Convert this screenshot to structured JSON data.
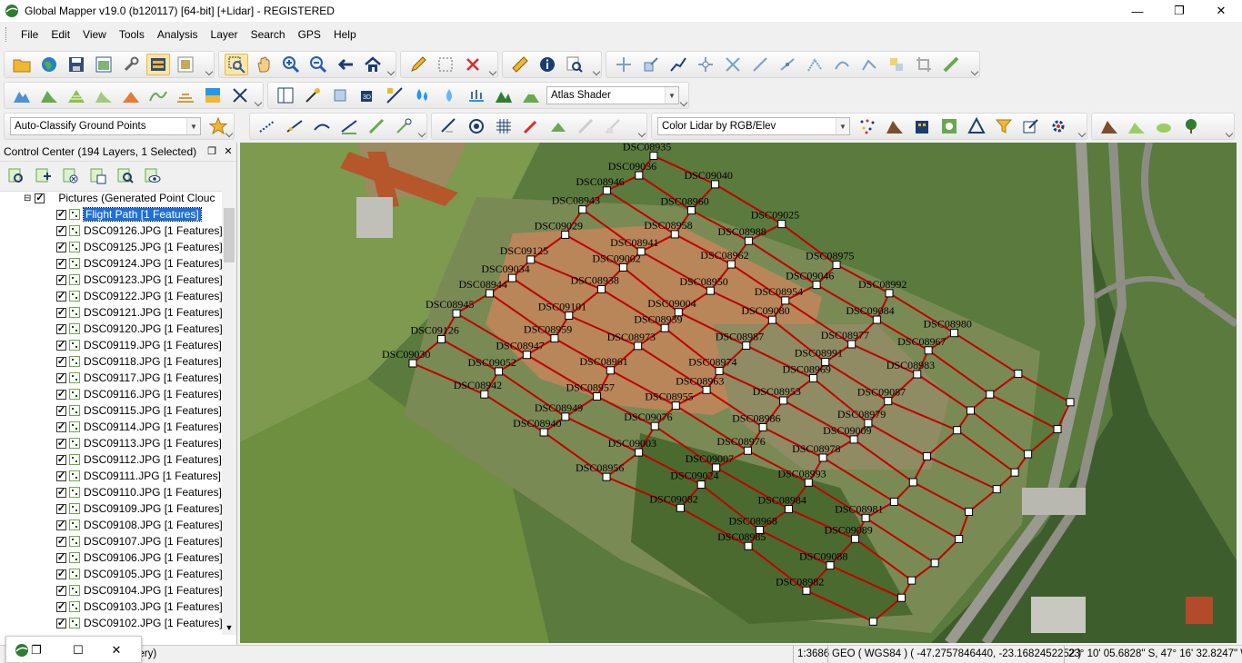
{
  "window": {
    "title": "Global Mapper v19.0 (b120117) [64-bit] [+Lidar] - REGISTERED",
    "minimize": "—",
    "maximize": "❐",
    "close": "✕"
  },
  "menu": [
    "File",
    "Edit",
    "View",
    "Tools",
    "Analysis",
    "Layer",
    "Search",
    "GPS",
    "Help"
  ],
  "toolbar": {
    "shader_value": "Atlas Shader",
    "classify_value": "Auto-Classify Ground Points",
    "lidar_color_value": "Color Lidar by RGB/Elev"
  },
  "control_center": {
    "title": "Control Center (194 Layers, 1 Selected)",
    "restore": "❐",
    "close": "✕",
    "group_label": "Pictures (Generated Point Clouc",
    "selected_layer": "Flight Path [1 Features]",
    "layers": [
      "DSC09126.JPG [1 Features]",
      "DSC09125.JPG [1 Features]",
      "DSC09124.JPG [1 Features]",
      "DSC09123.JPG [1 Features]",
      "DSC09122.JPG [1 Features]",
      "DSC09121.JPG [1 Features]",
      "DSC09120.JPG [1 Features]",
      "DSC09119.JPG [1 Features]",
      "DSC09118.JPG [1 Features]",
      "DSC09117.JPG [1 Features]",
      "DSC09116.JPG [1 Features]",
      "DSC09115.JPG [1 Features]",
      "DSC09114.JPG [1 Features]",
      "DSC09113.JPG [1 Features]",
      "DSC09112.JPG [1 Features]",
      "DSC09111.JPG [1 Features]",
      "DSC09110.JPG [1 Features]",
      "DSC09109.JPG [1 Features]",
      "DSC09108.JPG [1 Features]",
      "DSC09107.JPG [1 Features]",
      "DSC09106.JPG [1 Features]",
      "DSC09105.JPG [1 Features]",
      "DSC09104.JPG [1 Features]",
      "DSC09103.JPG [1 Features]",
      "DSC09102.JPG [1 Features]"
    ]
  },
  "map": {
    "line_color": "#c00000",
    "photo_labels": [
      "DSC09030",
      "DSC09126",
      "DSC08945",
      "DSC08944",
      "DSC09034",
      "DSC09125",
      "DSC09029",
      "DSC08943",
      "DSC08946",
      "DSC09036",
      "DSC08935",
      "DSC08942",
      "DSC09052",
      "DSC08947",
      "DSC08959",
      "DSC09101",
      "DSC08938",
      "DSC09002",
      "DSC08941",
      "DSC08958",
      "DSC08960",
      "DSC09040",
      "DSC08940",
      "DSC08949",
      "DSC08957",
      "DSC08961",
      "DSC08973",
      "DSC08939",
      "DSC09004",
      "DSC08950",
      "DSC08962",
      "DSC08988",
      "DSC09025",
      "DSC08956",
      "DSC09003",
      "DSC09076",
      "DSC08955",
      "DSC08963",
      "DSC08974",
      "DSC08987",
      "DSC09080",
      "DSC08954",
      "DSC09046",
      "DSC08975",
      "DSC09082",
      "DSC09024",
      "DSC09007",
      "DSC08976",
      "DSC08986",
      "DSC08953",
      "DSC08969",
      "DSC08991",
      "DSC08977",
      "DSC09084",
      "DSC08992",
      "DSC08985",
      "DSC08968",
      "DSC08984",
      "DSC08993",
      "DSC08978",
      "DSC09009",
      "DSC08979",
      "DSC09087",
      "DSC08983",
      "DSC08967",
      "DSC08980",
      "DSC08982",
      "DSC09088",
      "DSC09089",
      "DSC08981"
    ]
  },
  "status": {
    "left": "gery)",
    "scale": "1:3686",
    "geo": "GEO ( WGS84 ) ( -47.2757846440, -23.1682452252 )",
    "dms": "23° 10' 05.6828\" S, 47° 16' 32.8247\" W"
  }
}
